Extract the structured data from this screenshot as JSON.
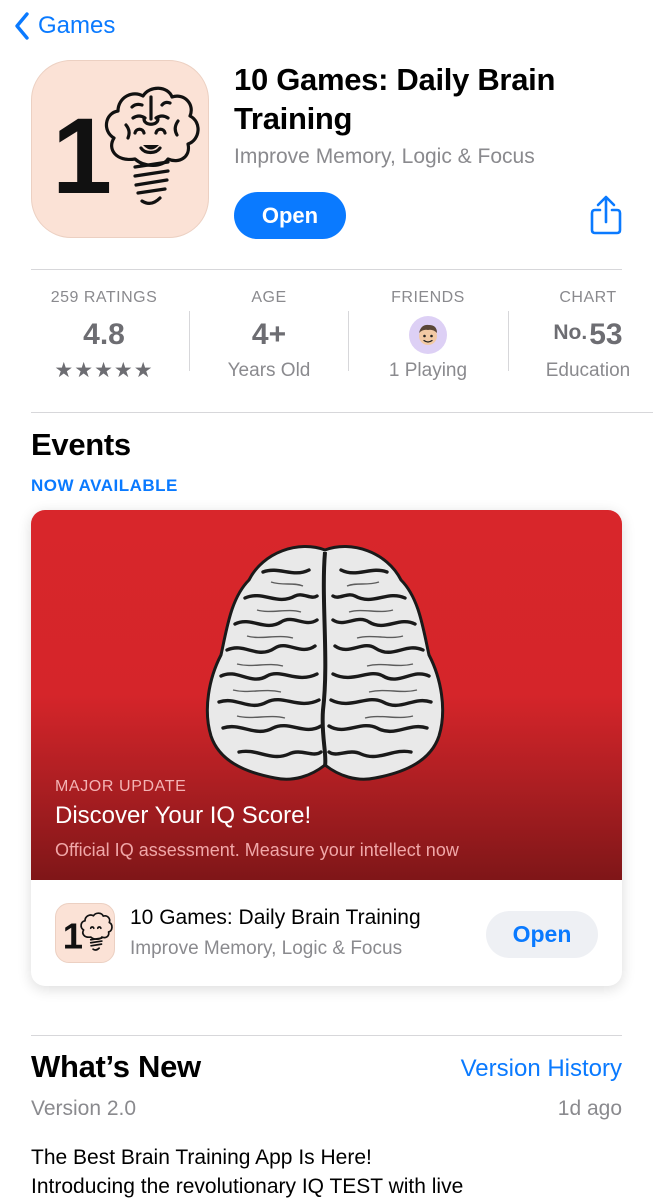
{
  "nav": {
    "back_label": "Games",
    "back_icon": "chevron-left-icon"
  },
  "app": {
    "title": "10 Games: Daily Brain Training",
    "subtitle": "Improve Memory, Logic & Focus",
    "open_label": "Open",
    "icon": "brain-lightbulb-app-icon",
    "icon_text": "1"
  },
  "share": {
    "icon": "share-icon"
  },
  "stats": {
    "ratings": {
      "label": "259 RATINGS",
      "value": "4.8",
      "stars": "★★★★★",
      "rating": 4.8,
      "max": 5
    },
    "age": {
      "label": "AGE",
      "value": "4+",
      "sub": "Years Old"
    },
    "friends": {
      "label": "FRIENDS",
      "sub": "1 Playing",
      "icon": "friend-avatar-icon"
    },
    "chart": {
      "label": "CHART",
      "prefix": "No.",
      "value": "53",
      "sub": "Education"
    }
  },
  "events": {
    "title": "Events",
    "status": "NOW AVAILABLE",
    "card": {
      "kind": "MAJOR UPDATE",
      "headline": "Discover Your IQ Score!",
      "description": "Official IQ assessment. Measure your intellect now",
      "image": "engraved-brain-illustration",
      "app_name": "10 Games: Daily Brain Training",
      "app_subtitle": "Improve Memory, Logic & Focus",
      "open_label": "Open"
    }
  },
  "whats_new": {
    "title": "What’s New",
    "history_link": "Version History",
    "version": "Version 2.0",
    "age": "1d ago",
    "notes_line1": "The Best Brain Training App Is Here!",
    "notes_line2": "Introducing the revolutionary IQ TEST with live"
  },
  "colors": {
    "accent": "#0a7aff",
    "icon_background": "#fbe2d6",
    "event_red": "#d8262b",
    "secondary_text": "#8a8a8e"
  }
}
